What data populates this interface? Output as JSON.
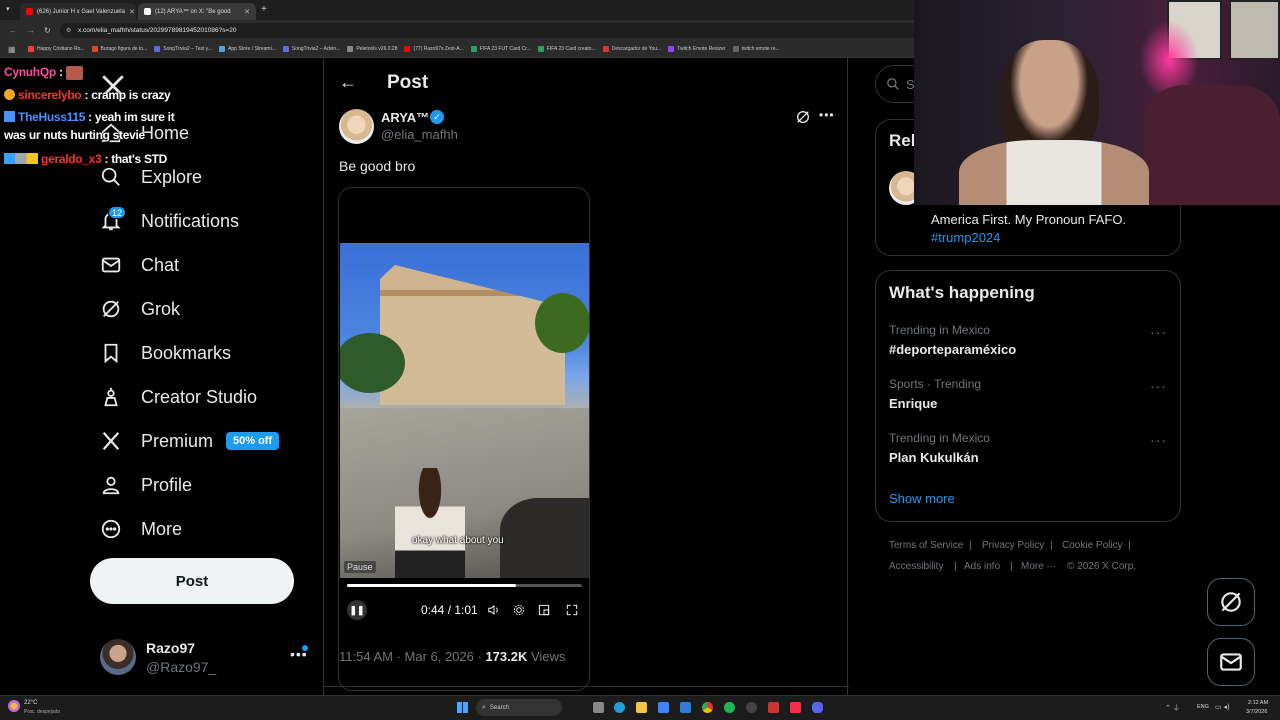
{
  "browser": {
    "tabs": [
      {
        "title": "(626) Junior H x Gael Valenzuela",
        "color": "#ff0000"
      },
      {
        "title": "(12) ARYA™ on X: \"Be good",
        "color": "#ffffff"
      }
    ],
    "url": "x.com/elia_mafhh/status/2029978981945201086?s=20",
    "bookmarks": [
      {
        "label": "Happy Cristiano Ro...",
        "color": "#ff3b3b"
      },
      {
        "label": "Burago figura de to...",
        "color": "#e04a2a"
      },
      {
        "label": "SongTrivia2 – Test y...",
        "color": "#5b6ee1"
      },
      {
        "label": "App Store / Streami...",
        "color": "#4fa3e0"
      },
      {
        "label": "SongTrivia2 – Advin...",
        "color": "#5b6ee1"
      },
      {
        "label": "Peletools v26.0.28",
        "color": "#888888"
      },
      {
        "label": "(77) Razo97s Zest-A...",
        "color": "#ff0000"
      },
      {
        "label": "FIFA 23 FUT Card Cr...",
        "color": "#2aa36b"
      },
      {
        "label": "FIFA 23 Card creato...",
        "color": "#2aa36b"
      },
      {
        "label": "Descargador de You...",
        "color": "#d33"
      },
      {
        "label": "Twitch Emote Resizer",
        "color": "#9146ff"
      },
      {
        "label": "twitch emote re...",
        "color": "#666666"
      }
    ]
  },
  "chat": [
    {
      "user": "CynuhQp",
      "color": "#ff4aa0",
      "text": ""
    },
    {
      "user": "sincerelybo",
      "color": "#ff3030",
      "text": "cramp is crazy"
    },
    {
      "user": "TheHuss115",
      "color": "#4a90ff",
      "text": "yeah im sure it"
    },
    {
      "user": "",
      "color": "#ffffff",
      "text": "was ur nuts hurting stevie"
    },
    {
      "user": "geraldo_x3",
      "color": "#ff3030",
      "text": "that's STD"
    }
  ],
  "nav": {
    "home": "Home",
    "explore": "Explore",
    "notifications": "Notifications",
    "notif_count": "12",
    "chat": "Chat",
    "grok": "Grok",
    "bookmarks": "Bookmarks",
    "creator_studio": "Creator Studio",
    "premium": "Premium",
    "premium_badge": "50% off",
    "profile": "Profile",
    "more": "More",
    "post_button": "Post"
  },
  "account": {
    "name": "Razo97",
    "handle": "@Razo97_"
  },
  "post": {
    "header": "Post",
    "author": "ARYA™",
    "handle": "@elia_mafhh",
    "text": "Be good bro",
    "caption": "okay what about you",
    "pause_label": "Pause",
    "time": "0:44 / 1:01",
    "progress": 0.72,
    "timestamp": "11:54 AM · Mar 6, 2026 · ",
    "views": "173.2K",
    "views_label": " Views"
  },
  "right": {
    "search_placeholder": "Se",
    "relevant_title": "Rel",
    "bio": "America First. My Pronoun FAFO.",
    "hashtag": "#trump2024",
    "happening_title": "What's happening",
    "trends": [
      {
        "meta": "Trending in Mexico",
        "name": "#deporteparaméxico"
      },
      {
        "meta": "Sports · Trending",
        "name": "Enrique"
      },
      {
        "meta": "Trending in Mexico",
        "name": "Plan Kukulkán"
      }
    ],
    "show_more": "Show more",
    "footer": {
      "terms": "Terms of Service",
      "privacy": "Privacy Policy",
      "cookie": "Cookie Policy",
      "accessibility": "Accessibility",
      "ads": "Ads info",
      "more": "More ···",
      "copyright": "© 2026 X Corp."
    }
  },
  "taskbar": {
    "weather_temp": "22°C",
    "weather_desc": "Prac. despejado",
    "search": "Search",
    "lang": "ENG",
    "time": "2:12 AM",
    "date": "3/7/2026"
  }
}
